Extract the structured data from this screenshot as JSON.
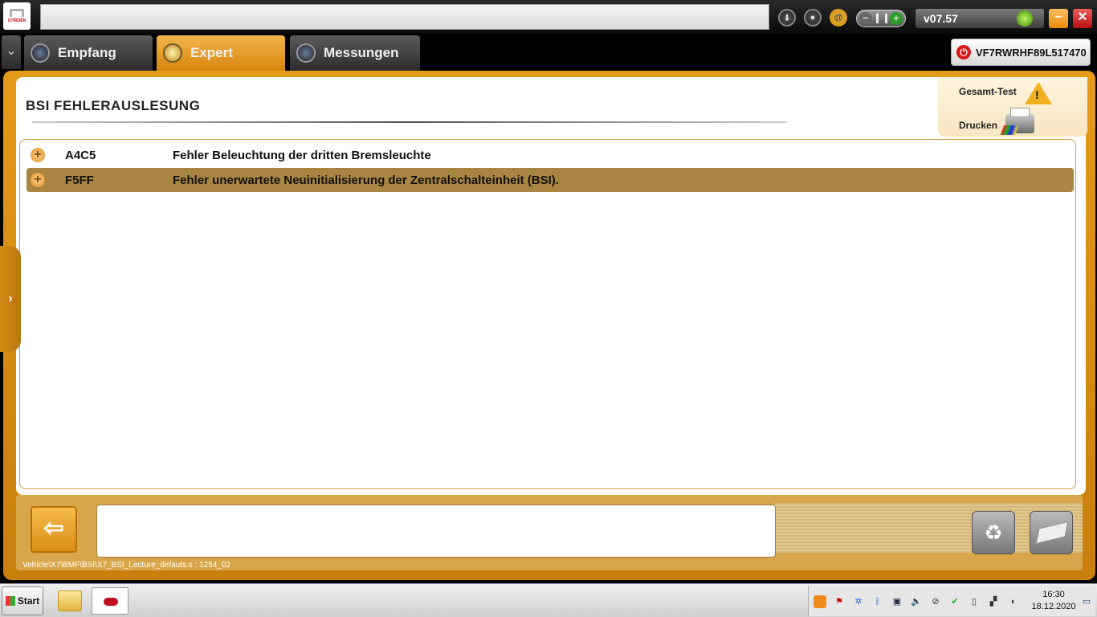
{
  "app": {
    "brand": "CITROËN",
    "version": "v07.57",
    "vin": "VF7RWRHF89L517470"
  },
  "tabs": [
    {
      "label": "Empfang"
    },
    {
      "label": "Expert"
    },
    {
      "label": "Messungen"
    }
  ],
  "main": {
    "title": "BSI  FEHLERAUSLESUNG",
    "actions": {
      "gesamt_test": "Gesamt-Test",
      "drucken": "Drucken"
    },
    "faults": [
      {
        "code": "A4C5",
        "desc": "Fehler Beleuchtung der dritten Bremsleuchte"
      },
      {
        "code": "F5FF",
        "desc": "Fehler unerwartete Neuinitialisierung der Zentralschalteinheit (BSI)."
      }
    ],
    "path": "Vehicle\\X7\\BMF\\BSI\\X7_BSI_Lecture_defauts.s : 1254_02"
  },
  "taskbar": {
    "start": "Start",
    "time": "16:30",
    "date": "18.12.2020"
  },
  "icons": {
    "download": "download-icon",
    "user": "user-icon",
    "at": "at-icon",
    "power": "power-icon",
    "trash": "recycle-bin-icon",
    "eraser": "eraser-icon",
    "back": "back-arrow-icon"
  },
  "colors": {
    "accent": "#e69a1a",
    "selected_row": "#a88540",
    "power_red": "#d81818"
  }
}
